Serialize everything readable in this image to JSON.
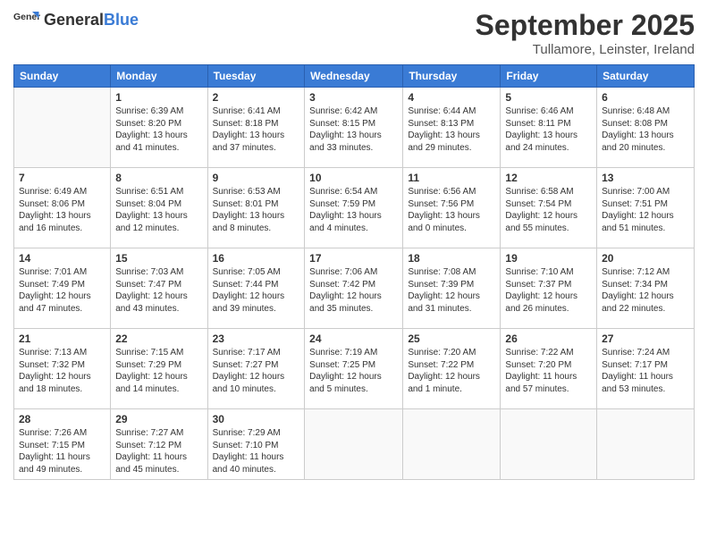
{
  "header": {
    "logo_general": "General",
    "logo_blue": "Blue",
    "month": "September 2025",
    "location": "Tullamore, Leinster, Ireland"
  },
  "columns": [
    "Sunday",
    "Monday",
    "Tuesday",
    "Wednesday",
    "Thursday",
    "Friday",
    "Saturday"
  ],
  "weeks": [
    [
      {
        "day": "",
        "info": ""
      },
      {
        "day": "1",
        "info": "Sunrise: 6:39 AM\nSunset: 8:20 PM\nDaylight: 13 hours\nand 41 minutes."
      },
      {
        "day": "2",
        "info": "Sunrise: 6:41 AM\nSunset: 8:18 PM\nDaylight: 13 hours\nand 37 minutes."
      },
      {
        "day": "3",
        "info": "Sunrise: 6:42 AM\nSunset: 8:15 PM\nDaylight: 13 hours\nand 33 minutes."
      },
      {
        "day": "4",
        "info": "Sunrise: 6:44 AM\nSunset: 8:13 PM\nDaylight: 13 hours\nand 29 minutes."
      },
      {
        "day": "5",
        "info": "Sunrise: 6:46 AM\nSunset: 8:11 PM\nDaylight: 13 hours\nand 24 minutes."
      },
      {
        "day": "6",
        "info": "Sunrise: 6:48 AM\nSunset: 8:08 PM\nDaylight: 13 hours\nand 20 minutes."
      }
    ],
    [
      {
        "day": "7",
        "info": "Sunrise: 6:49 AM\nSunset: 8:06 PM\nDaylight: 13 hours\nand 16 minutes."
      },
      {
        "day": "8",
        "info": "Sunrise: 6:51 AM\nSunset: 8:04 PM\nDaylight: 13 hours\nand 12 minutes."
      },
      {
        "day": "9",
        "info": "Sunrise: 6:53 AM\nSunset: 8:01 PM\nDaylight: 13 hours\nand 8 minutes."
      },
      {
        "day": "10",
        "info": "Sunrise: 6:54 AM\nSunset: 7:59 PM\nDaylight: 13 hours\nand 4 minutes."
      },
      {
        "day": "11",
        "info": "Sunrise: 6:56 AM\nSunset: 7:56 PM\nDaylight: 13 hours\nand 0 minutes."
      },
      {
        "day": "12",
        "info": "Sunrise: 6:58 AM\nSunset: 7:54 PM\nDaylight: 12 hours\nand 55 minutes."
      },
      {
        "day": "13",
        "info": "Sunrise: 7:00 AM\nSunset: 7:51 PM\nDaylight: 12 hours\nand 51 minutes."
      }
    ],
    [
      {
        "day": "14",
        "info": "Sunrise: 7:01 AM\nSunset: 7:49 PM\nDaylight: 12 hours\nand 47 minutes."
      },
      {
        "day": "15",
        "info": "Sunrise: 7:03 AM\nSunset: 7:47 PM\nDaylight: 12 hours\nand 43 minutes."
      },
      {
        "day": "16",
        "info": "Sunrise: 7:05 AM\nSunset: 7:44 PM\nDaylight: 12 hours\nand 39 minutes."
      },
      {
        "day": "17",
        "info": "Sunrise: 7:06 AM\nSunset: 7:42 PM\nDaylight: 12 hours\nand 35 minutes."
      },
      {
        "day": "18",
        "info": "Sunrise: 7:08 AM\nSunset: 7:39 PM\nDaylight: 12 hours\nand 31 minutes."
      },
      {
        "day": "19",
        "info": "Sunrise: 7:10 AM\nSunset: 7:37 PM\nDaylight: 12 hours\nand 26 minutes."
      },
      {
        "day": "20",
        "info": "Sunrise: 7:12 AM\nSunset: 7:34 PM\nDaylight: 12 hours\nand 22 minutes."
      }
    ],
    [
      {
        "day": "21",
        "info": "Sunrise: 7:13 AM\nSunset: 7:32 PM\nDaylight: 12 hours\nand 18 minutes."
      },
      {
        "day": "22",
        "info": "Sunrise: 7:15 AM\nSunset: 7:29 PM\nDaylight: 12 hours\nand 14 minutes."
      },
      {
        "day": "23",
        "info": "Sunrise: 7:17 AM\nSunset: 7:27 PM\nDaylight: 12 hours\nand 10 minutes."
      },
      {
        "day": "24",
        "info": "Sunrise: 7:19 AM\nSunset: 7:25 PM\nDaylight: 12 hours\nand 5 minutes."
      },
      {
        "day": "25",
        "info": "Sunrise: 7:20 AM\nSunset: 7:22 PM\nDaylight: 12 hours\nand 1 minute."
      },
      {
        "day": "26",
        "info": "Sunrise: 7:22 AM\nSunset: 7:20 PM\nDaylight: 11 hours\nand 57 minutes."
      },
      {
        "day": "27",
        "info": "Sunrise: 7:24 AM\nSunset: 7:17 PM\nDaylight: 11 hours\nand 53 minutes."
      }
    ],
    [
      {
        "day": "28",
        "info": "Sunrise: 7:26 AM\nSunset: 7:15 PM\nDaylight: 11 hours\nand 49 minutes."
      },
      {
        "day": "29",
        "info": "Sunrise: 7:27 AM\nSunset: 7:12 PM\nDaylight: 11 hours\nand 45 minutes."
      },
      {
        "day": "30",
        "info": "Sunrise: 7:29 AM\nSunset: 7:10 PM\nDaylight: 11 hours\nand 40 minutes."
      },
      {
        "day": "",
        "info": ""
      },
      {
        "day": "",
        "info": ""
      },
      {
        "day": "",
        "info": ""
      },
      {
        "day": "",
        "info": ""
      }
    ]
  ]
}
